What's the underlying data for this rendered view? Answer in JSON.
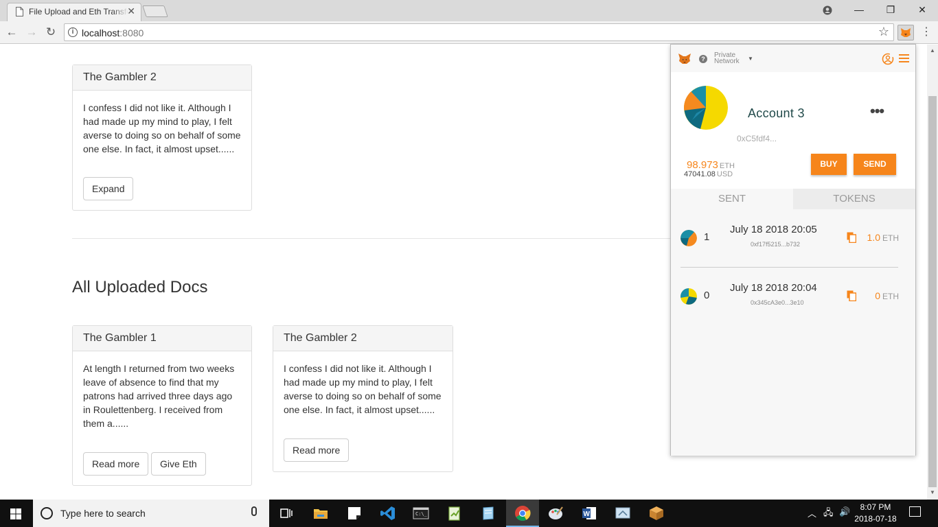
{
  "browser": {
    "tab_title": "File Upload and Eth Transfer",
    "url_host": "localhost",
    "url_port": ":8080"
  },
  "page": {
    "top_card": {
      "title": "The Gambler 2",
      "body": "I confess I did not like it. Although I had made up my mind to play, I felt averse to doing so on behalf of some one else. In fact, it almost upset......",
      "button": "Expand"
    },
    "section_title": "All Uploaded Docs",
    "docs": [
      {
        "title": "The Gambler 1",
        "body": "At length I returned from two weeks leave of absence to find that my patrons had arrived three days ago in Roulettenberg. I received from them a......",
        "read_more": "Read more",
        "give_eth": "Give Eth"
      },
      {
        "title": "The Gambler 2",
        "body": "I confess I did not like it. Although I had made up my mind to play, I felt averse to doing so on behalf of some one else. In fact, it almost upset......",
        "read_more": "Read more"
      }
    ]
  },
  "metamask": {
    "network_line1": "Private",
    "network_line2": "Network",
    "account_name": "Account 3",
    "account_address": "0xC5fdf4...",
    "eth_balance": "98.973",
    "eth_unit": "ETH",
    "usd_balance": "47041.08",
    "usd_unit": "USD",
    "buy_label": "BUY",
    "send_label": "SEND",
    "tabs": {
      "sent": "SENT",
      "tokens": "TOKENS"
    },
    "transactions": [
      {
        "nonce": "1",
        "date": "July 18 2018 20:05",
        "hash": "0xf17f5215...b732",
        "amount": "1.0",
        "unit": "ETH"
      },
      {
        "nonce": "0",
        "date": "July 18 2018 20:04",
        "hash": "0x345cA3e0...3e10",
        "amount": "0",
        "unit": "ETH"
      }
    ],
    "colors": {
      "accent": "#f6851b",
      "name": "#214a4a"
    }
  },
  "taskbar": {
    "search_placeholder": "Type here to search",
    "time": "8:07 PM",
    "date": "2018-07-18"
  }
}
